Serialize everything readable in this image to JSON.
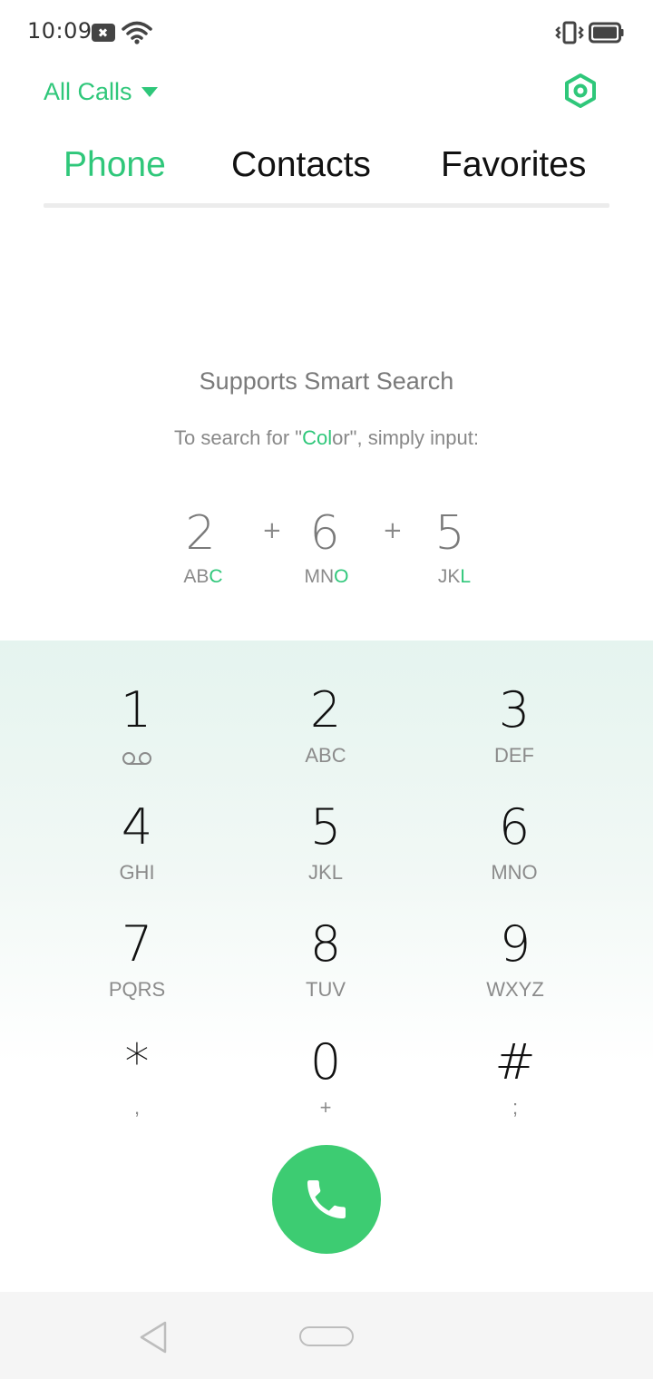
{
  "status_bar": {
    "time": "10:09",
    "icons": [
      "notification-x-icon",
      "wifi-icon",
      "vibrate-icon",
      "battery-icon"
    ]
  },
  "header": {
    "filter_label": "All Calls",
    "settings_icon": "settings-hex-icon",
    "accent_color": "#2fc77a"
  },
  "tabs": [
    {
      "label": "Phone",
      "active": true
    },
    {
      "label": "Contacts",
      "active": false
    },
    {
      "label": "Favorites",
      "active": false
    }
  ],
  "smart_search": {
    "title": "Supports Smart Search",
    "subtitle_prefix": "To search for \"",
    "subtitle_highlight": "Col",
    "subtitle_word_rest": "or",
    "subtitle_suffix": "\", simply input:",
    "example": [
      {
        "digit": "2",
        "letters_plain": "AB",
        "letters_highlight": "C"
      },
      {
        "digit": "6",
        "letters_plain": "MN",
        "letters_highlight": "O"
      },
      {
        "digit": "5",
        "letters_plain": "JK",
        "letters_highlight": "L"
      }
    ],
    "plus_sign": "+"
  },
  "dialpad": {
    "keys": [
      {
        "digit": "1",
        "letters": "",
        "icon": "voicemail-icon"
      },
      {
        "digit": "2",
        "letters": "ABC"
      },
      {
        "digit": "3",
        "letters": "DEF"
      },
      {
        "digit": "4",
        "letters": "GHI"
      },
      {
        "digit": "5",
        "letters": "JKL"
      },
      {
        "digit": "6",
        "letters": "MNO"
      },
      {
        "digit": "7",
        "letters": "PQRS"
      },
      {
        "digit": "8",
        "letters": "TUV"
      },
      {
        "digit": "9",
        "letters": "WXYZ"
      },
      {
        "digit": "*",
        "letters": ","
      },
      {
        "digit": "0",
        "letters": "+"
      },
      {
        "digit": "#",
        "letters": ";"
      }
    ],
    "call_icon": "phone-icon",
    "call_color": "#3dcc72"
  },
  "nav_bar": {
    "back_icon": "back-triangle-icon",
    "home_icon": "home-pill-icon"
  }
}
